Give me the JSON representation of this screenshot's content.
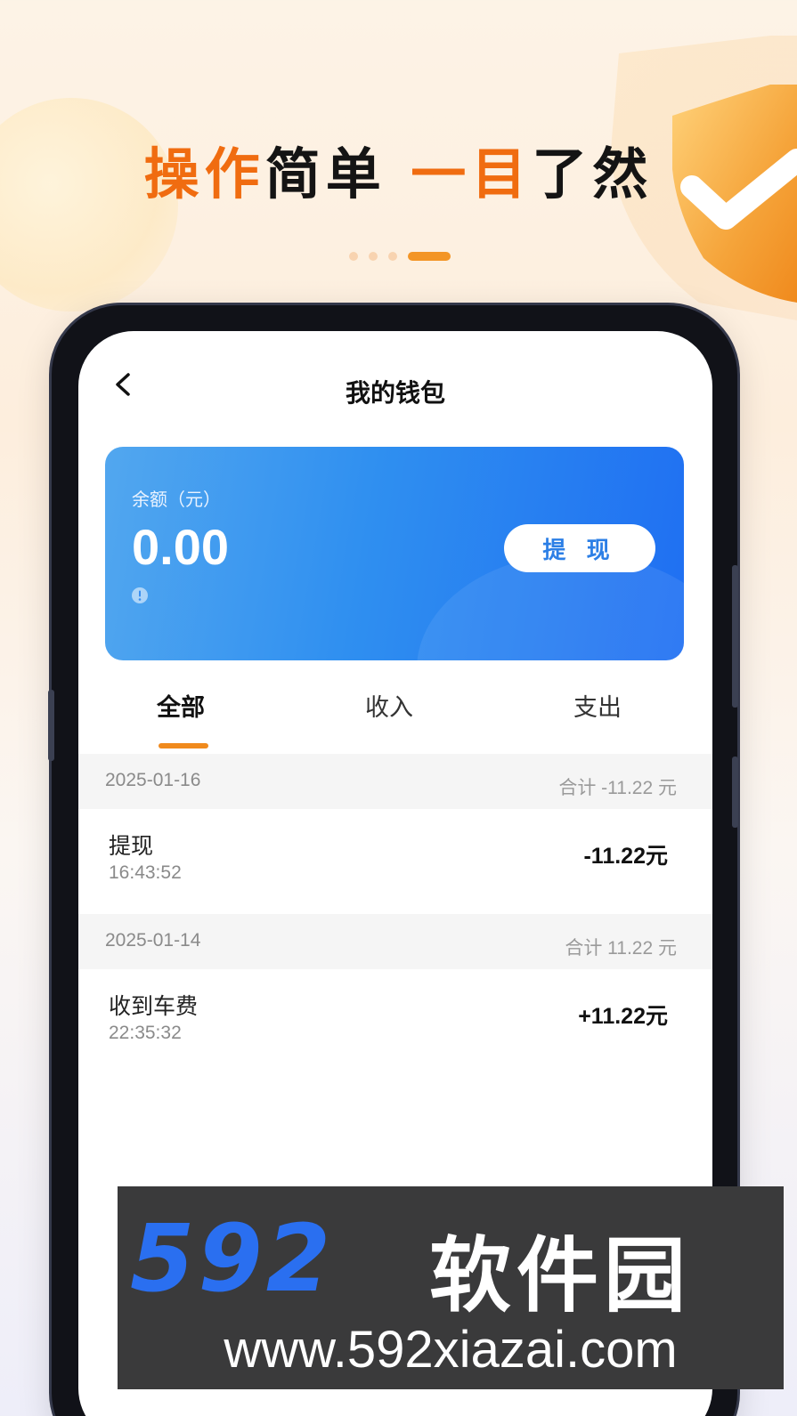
{
  "promo": {
    "headline_part1": "操作",
    "headline_part2": "简单",
    "headline_part3": "一目",
    "headline_part4": "了然",
    "accent_color": "#f06c10",
    "active_dot_color": "#f39526"
  },
  "app": {
    "title": "我的钱包",
    "wallet": {
      "balance_label": "余额（元）",
      "balance_value": "0.00",
      "withdraw_label": "提 现",
      "card_color": "#2f8ff0"
    },
    "tabs": [
      {
        "label": "全部",
        "active": true
      },
      {
        "label": "收入",
        "active": false
      },
      {
        "label": "支出",
        "active": false
      }
    ],
    "groups": [
      {
        "date": "2025-01-16",
        "total": "合计 -11.22 元",
        "records": [
          {
            "name": "提现",
            "time": "16:43:52",
            "amount": "-11.22元"
          }
        ]
      },
      {
        "date": "2025-01-14",
        "total": "合计 11.22 元",
        "records": [
          {
            "name": "收到车费",
            "time": "22:35:32",
            "amount": "+11.22元"
          }
        ]
      }
    ]
  },
  "watermark": {
    "logo_number": "592",
    "logo_text": "软件园",
    "url": "www.592xiazai.com"
  }
}
